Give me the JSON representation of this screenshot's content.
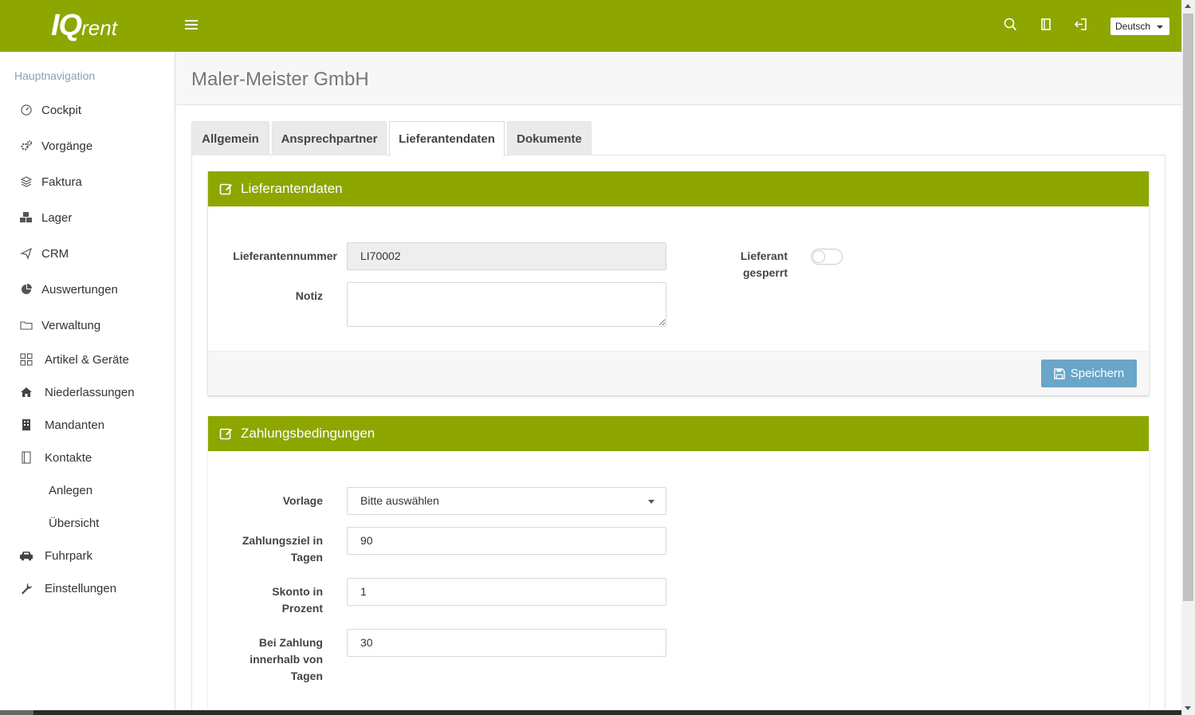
{
  "header": {
    "logo_iq": "IQ",
    "logo_rent": "rent",
    "language": "Deutsch",
    "icons": [
      "search-icon",
      "book-icon",
      "logout-icon"
    ],
    "brand_color": "#8ea600"
  },
  "sidebar": {
    "header": "Hauptnavigation",
    "items": [
      {
        "label": "Cockpit",
        "icon": "dashboard-icon"
      },
      {
        "label": "Vorgänge",
        "icon": "gears-icon"
      },
      {
        "label": "Faktura",
        "icon": "layers-icon"
      },
      {
        "label": "Lager",
        "icon": "cubes-icon"
      },
      {
        "label": "CRM",
        "icon": "paper-plane-icon"
      },
      {
        "label": "Auswertungen",
        "icon": "pie-chart-icon"
      },
      {
        "label": "Verwaltung",
        "icon": "folder-icon"
      },
      {
        "label": "Artikel & Geräte",
        "icon": "grid-icon"
      },
      {
        "label": "Niederlassungen",
        "icon": "home-icon"
      },
      {
        "label": "Mandanten",
        "icon": "building-icon"
      },
      {
        "label": "Kontakte",
        "icon": "address-book-icon"
      },
      {
        "label": "Anlegen",
        "icon": ""
      },
      {
        "label": "Übersicht",
        "icon": ""
      },
      {
        "label": "Fuhrpark",
        "icon": "car-icon"
      },
      {
        "label": "Einstellungen",
        "icon": "wrench-icon"
      }
    ]
  },
  "page": {
    "title": "Maler-Meister GmbH",
    "tabs": [
      {
        "label": "Allgemein"
      },
      {
        "label": "Ansprechpartner"
      },
      {
        "label": "Lieferantendaten",
        "active": true
      },
      {
        "label": "Dokumente"
      }
    ]
  },
  "supplier_card": {
    "title": "Lieferantendaten",
    "number_label": "Lieferantennummer",
    "number_value": "LI70002",
    "note_label": "Notiz",
    "note_value": "",
    "blocked_label_1": "Lieferant",
    "blocked_label_2": "gesperrt",
    "blocked": false,
    "save_label": "Speichern"
  },
  "payment_card": {
    "title": "Zahlungsbedingungen",
    "template_label": "Vorlage",
    "template_value": "Bitte auswählen",
    "term_label_1": "Zahlungsziel in",
    "term_label_2": "Tagen",
    "term_value": "90",
    "discount_label_1": "Skonto in",
    "discount_label_2": "Prozent",
    "discount_value": "1",
    "within_label_1": "Bei Zahlung",
    "within_label_2": "innerhalb von",
    "within_label_3": "Tagen",
    "within_value": "30"
  }
}
